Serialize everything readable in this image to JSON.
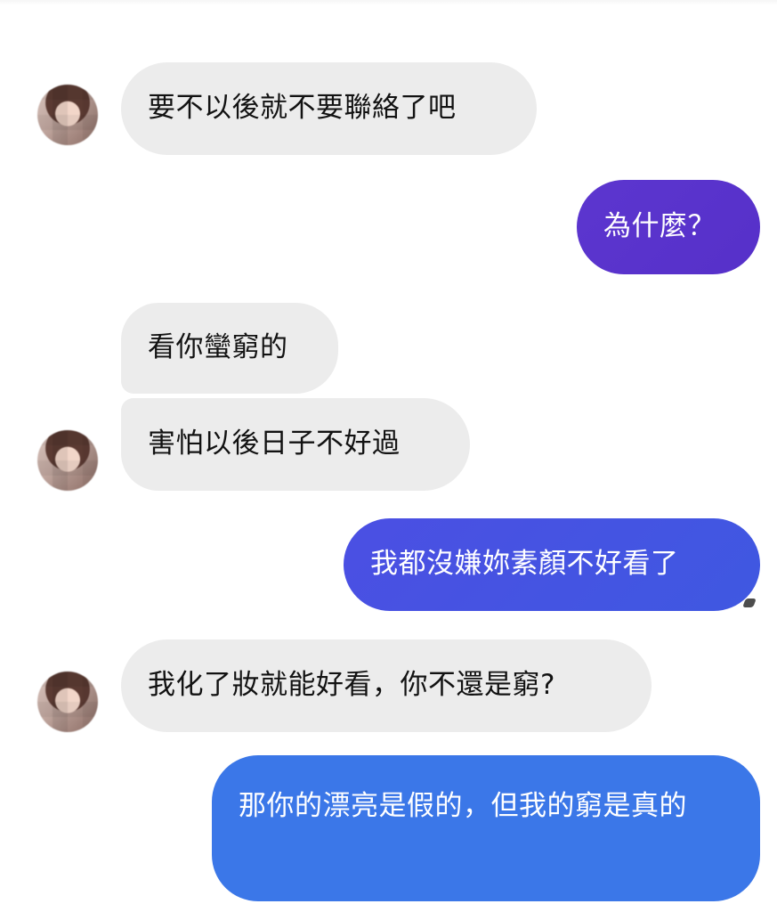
{
  "messages": [
    {
      "side": "in",
      "text": "要不以後就不要聯絡了吧"
    },
    {
      "side": "out",
      "text": "為什麼？"
    },
    {
      "side": "in",
      "text": "看你蠻窮的"
    },
    {
      "side": "in",
      "text": "害怕以後日子不好過"
    },
    {
      "side": "out",
      "text": "我都沒嫌妳素顏不好看了"
    },
    {
      "side": "in",
      "text": "我化了妝就能好看，你不還是窮?"
    },
    {
      "side": "out",
      "text": "那你的漂亮是假的，但我的窮是真的"
    }
  ],
  "colors": {
    "incoming_bubble": "#ececec",
    "outgoing_purple": "#5c36cf",
    "outgoing_indigo": "#4b4fe3",
    "outgoing_blue": "#3b77e8",
    "background": "#ffffff"
  },
  "icons": {
    "avatar": "profile-avatar",
    "read_indicator": "mini-read-receipt-icon"
  }
}
